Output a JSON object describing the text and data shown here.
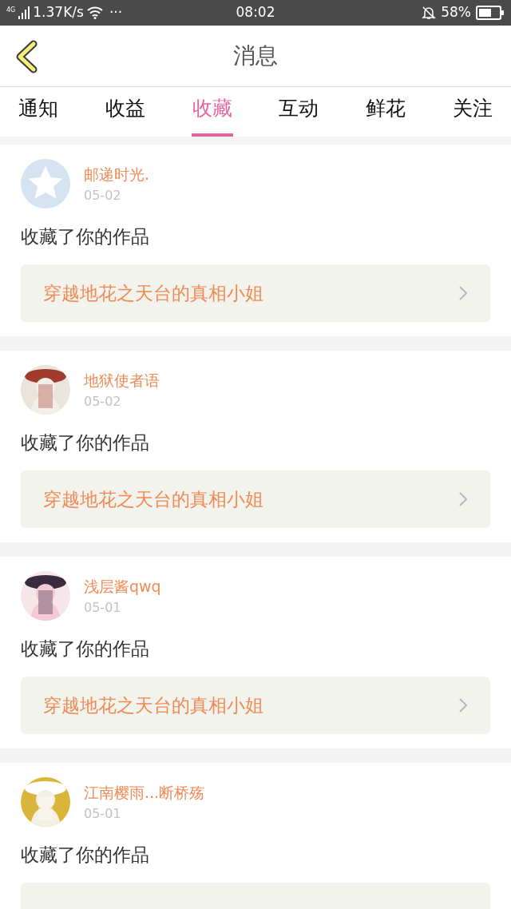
{
  "status_bar": {
    "network": "4G",
    "speed": "1.37K/s",
    "more": "···",
    "time": "08:02",
    "battery": "58%"
  },
  "header": {
    "title": "消息"
  },
  "tabs": [
    {
      "label": "通知",
      "selected": false
    },
    {
      "label": "收益",
      "selected": false
    },
    {
      "label": "收藏",
      "selected": true
    },
    {
      "label": "互动",
      "selected": false
    },
    {
      "label": "鲜花",
      "selected": false
    },
    {
      "label": "关注",
      "selected": false
    }
  ],
  "messages": [
    {
      "avatar": {
        "kind": "default"
      },
      "name": "邮递时光.",
      "date": "05-02",
      "text": "收藏了你的作品",
      "work": "穿越地花之天台的真相小姐"
    },
    {
      "name": "地狱使者语",
      "date": "05-02",
      "text": "收藏了你的作品",
      "work": "穿越地花之天台的真相小姐"
    },
    {
      "name": "浅层酱qwq",
      "date": "05-01",
      "text": "收藏了你的作品",
      "work": "穿越地花之天台的真相小姐"
    },
    {
      "name": "江南樱雨...断桥殇",
      "date": "05-01",
      "text": "收藏了你的作品"
    }
  ]
}
